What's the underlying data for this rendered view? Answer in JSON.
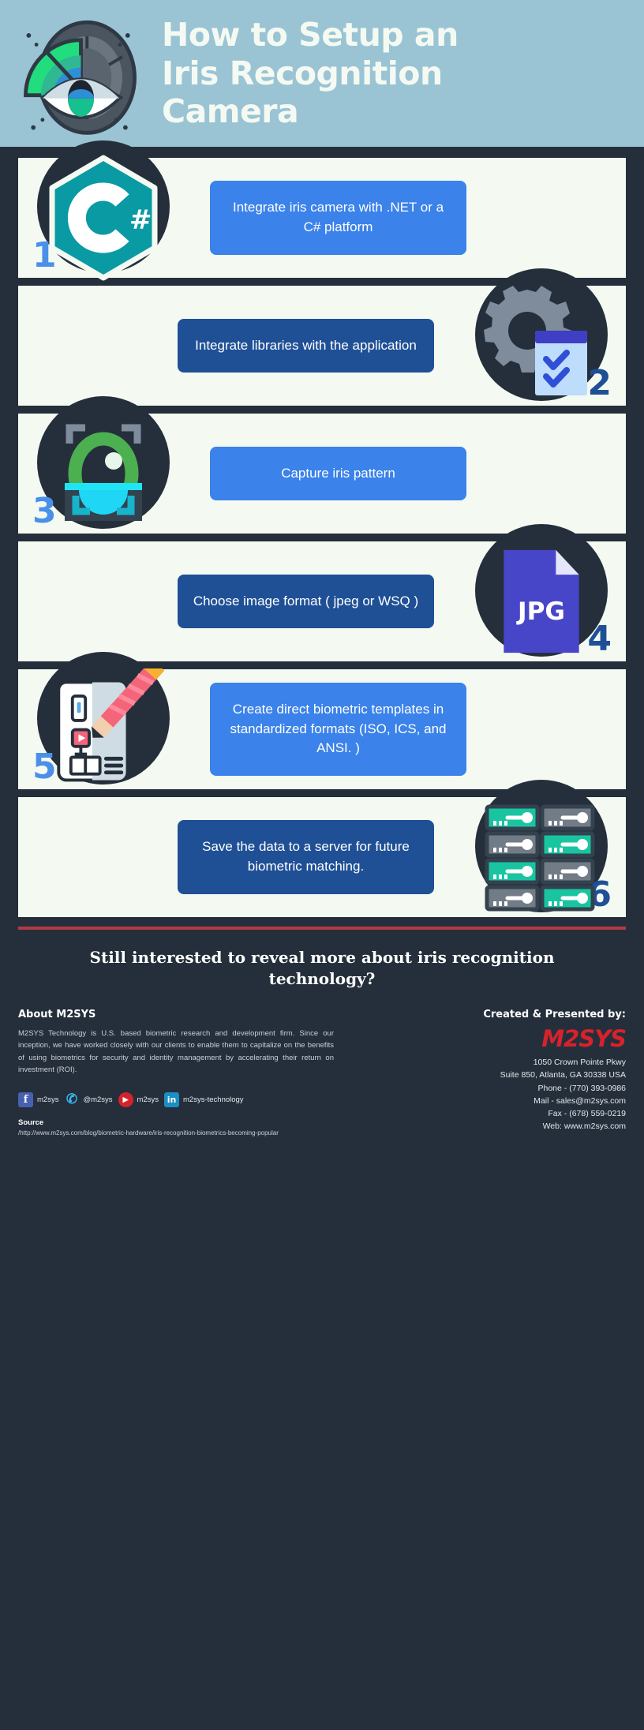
{
  "header": {
    "title_line1": "How to Setup an",
    "title_line2": "Iris Recognition",
    "title_line3": "Camera",
    "icon": "iris-camera-gauge-icon",
    "bg_color": "#9ac4d4",
    "title_color": "#f4faf2"
  },
  "theme": {
    "page_bg": "#252f3b",
    "card_bg": "#f4faf2",
    "accent_light_blue": "#3b82ea",
    "accent_dark_blue": "#1f5096",
    "number_light": "#4a90e8",
    "number_dark": "#1f5096",
    "rule_red": "#b33a45",
    "brand_red": "#d7222c"
  },
  "steps": [
    {
      "number": "1",
      "text": "Integrate iris camera with .NET or a C# platform",
      "icon": "csharp-hexagon-icon",
      "icon_side": "left",
      "box_style": "light",
      "number_side": "left",
      "number_style": "light"
    },
    {
      "number": "2",
      "text": "Integrate  libraries with the application",
      "icon": "gear-checklist-icon",
      "icon_side": "right",
      "box_style": "dark",
      "number_side": "right",
      "number_style": "dark"
    },
    {
      "number": "3",
      "text": "Capture iris pattern",
      "icon": "iris-scanner-icon",
      "icon_side": "left",
      "box_style": "light",
      "number_side": "left",
      "number_style": "light"
    },
    {
      "number": "4",
      "text": "Choose image format ( jpeg or WSQ )",
      "icon": "jpg-file-icon",
      "icon_side": "right",
      "box_style": "dark",
      "number_side": "right",
      "number_style": "dark",
      "file_label": "JPG"
    },
    {
      "number": "5",
      "text": "Create direct biometric templates in standardized formats (ISO, ICS, and ANSI. )",
      "icon": "document-pencil-icon",
      "icon_side": "left",
      "box_style": "light",
      "number_side": "left",
      "number_style": "light"
    },
    {
      "number": "6",
      "text": "Save the data to a server for future biometric matching.",
      "icon": "server-rack-icon",
      "icon_side": "right",
      "box_style": "dark",
      "number_side": "right",
      "number_style": "dark"
    }
  ],
  "footer": {
    "cta": "Still interested to reveal more about iris recognition technology?",
    "about_heading": "About M2SYS",
    "about_body": "M2SYS Technology is U.S. based biometric research and development firm. Since our inception, we have worked closely with our clients to enable them to capitalize on the benefits of using biometrics for security and identity management by accelerating their return on investment (ROI).",
    "created_heading": "Created & Presented by:",
    "logo_text": "M2SYS",
    "address": [
      "1050 Crown Pointe Pkwy",
      "Suite 850, Atlanta, GA 30338 USA",
      "Phone - (770) 393-0986",
      "Mail - sales@m2sys.com",
      "Fax - (678) 559-0219",
      "Web: www.m2sys.com"
    ],
    "socials": [
      {
        "icon": "facebook-icon",
        "glyph": "f",
        "label": "m2sys"
      },
      {
        "icon": "twitter-icon",
        "glyph": "✆",
        "label": "@m2sys"
      },
      {
        "icon": "youtube-icon",
        "glyph": "▶",
        "label": "m2sys"
      },
      {
        "icon": "linkedin-icon",
        "glyph": "in",
        "label": "m2sys-technology"
      }
    ],
    "source_heading": "Source",
    "source_url": "/http://www.m2sys.com/blog/biometric-hardware/iris-recognition-biometrics-becoming-popular"
  }
}
